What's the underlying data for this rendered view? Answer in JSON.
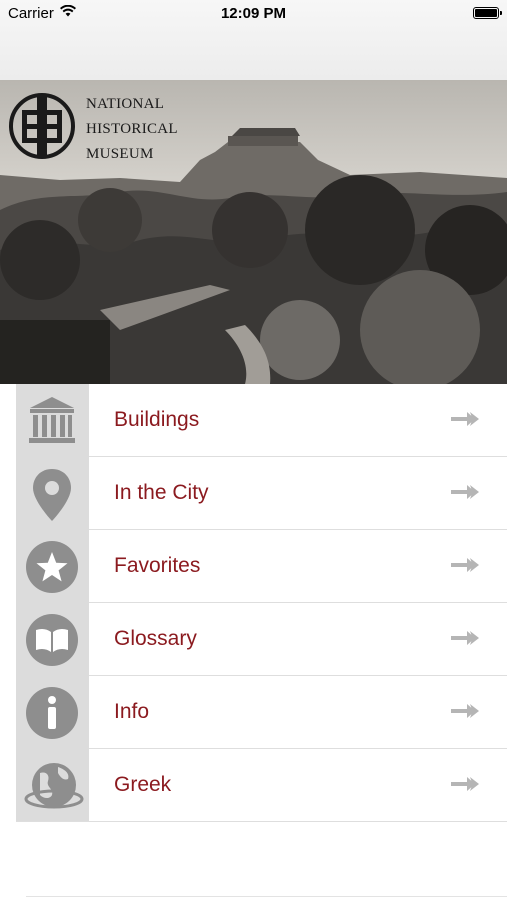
{
  "status_bar": {
    "carrier": "Carrier",
    "time": "12:09 PM"
  },
  "header": {
    "museum_name_lines": [
      "NATIONAL",
      "HISTORICAL",
      "MUSEUM"
    ]
  },
  "menu": {
    "items": [
      {
        "label": "Buildings",
        "icon": "building-icon"
      },
      {
        "label": "In the City",
        "icon": "map-pin-icon"
      },
      {
        "label": "Favorites",
        "icon": "star-icon"
      },
      {
        "label": "Glossary",
        "icon": "book-icon"
      },
      {
        "label": "Info",
        "icon": "info-icon"
      },
      {
        "label": "Greek",
        "icon": "globe-icon"
      }
    ]
  },
  "colors": {
    "label": "#8b1a1f",
    "icon_gray": "#8e8e8e",
    "icon_bg": "#dcdcdc",
    "chevron": "#b5b5b5"
  }
}
